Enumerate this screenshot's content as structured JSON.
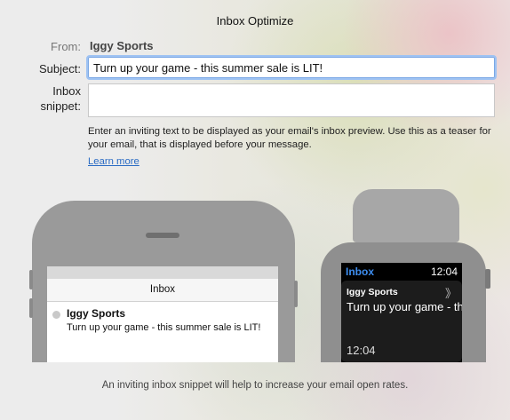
{
  "window": {
    "title": "Inbox Optimize"
  },
  "form": {
    "from_label": "From:",
    "from_value": "Iggy Sports",
    "subject_label": "Subject:",
    "subject_value": "Turn up your game - this summer sale is LIT!",
    "snippet_label_1": "Inbox",
    "snippet_label_2": "snippet:",
    "snippet_value": "",
    "help_text": "Enter an inviting text to be displayed as your email's inbox preview. Use this as a teaser for your email, that is displayed before your message.",
    "learn_more": "Learn more"
  },
  "phone_preview": {
    "nav_title": "Inbox",
    "sender": "Iggy Sports",
    "subject": "Turn up your game - this summer sale is LIT!"
  },
  "watch_preview": {
    "app_label": "Inbox",
    "clock": "12:04",
    "sender": "Iggy Sports",
    "chevron": "》",
    "subject": "Turn up your game - this summer sale is LIT!",
    "time": "12:04"
  },
  "footer": {
    "text": "An inviting inbox snippet will help to increase your email open rates."
  }
}
